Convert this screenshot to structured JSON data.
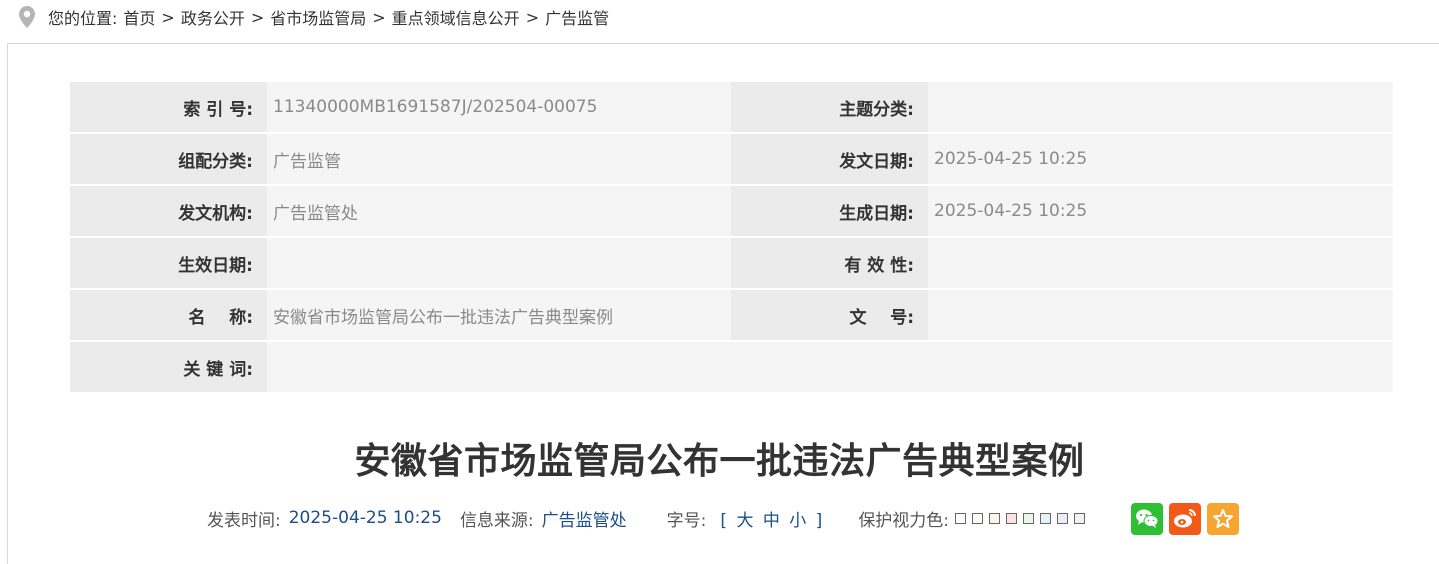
{
  "breadcrumb": {
    "prefix": "您的位置:",
    "items": [
      "首页",
      "政务公开",
      "省市场监管局",
      "重点领域信息公开",
      "广告监管"
    ],
    "separator": ">"
  },
  "meta": {
    "rows": [
      {
        "k1": "索 引 号:",
        "v1": "11340000MB1691587J/202504-00075",
        "k2": "主题分类:",
        "v2": ""
      },
      {
        "k1": "组配分类:",
        "v1": "广告监管",
        "k2": "发文日期:",
        "v2": "2025-04-25 10:25"
      },
      {
        "k1": "发文机构:",
        "v1": "广告监管处",
        "k2": "生成日期:",
        "v2": "2025-04-25 10:25"
      },
      {
        "k1": "生效日期:",
        "v1": "",
        "k2": "有 效 性:",
        "v2": ""
      },
      {
        "k1": "名    称:",
        "v1": "安徽省市场监管局公布一批违法广告典型案例",
        "k2": "文    号:",
        "v2": ""
      },
      {
        "k1": "关 键 词:",
        "v1": ""
      }
    ]
  },
  "article": {
    "title": "安徽省市场监管局公布一批违法广告典型案例",
    "publish_label": "发表时间:",
    "publish_time": "2025-04-25 10:25",
    "source_label": "信息来源:",
    "source": "广告监管处",
    "font_label": "字号:",
    "font_open": "[",
    "font_large": "大",
    "font_medium": "中",
    "font_small": "小",
    "font_close": "]",
    "eye_label": "保护视力色:"
  },
  "swatch_colors": [
    "#ffffff",
    "#fafff0",
    "#fdf3e6",
    "#fbe3e3",
    "#eaf7e6",
    "#e3f2f7",
    "#ececf5",
    "#f2f2f2"
  ],
  "share": {
    "icons": [
      "wechat-icon",
      "weibo-icon",
      "favorite-icon"
    ],
    "colors": [
      "#2fbf33",
      "#f35a17",
      "#f7a531"
    ]
  }
}
